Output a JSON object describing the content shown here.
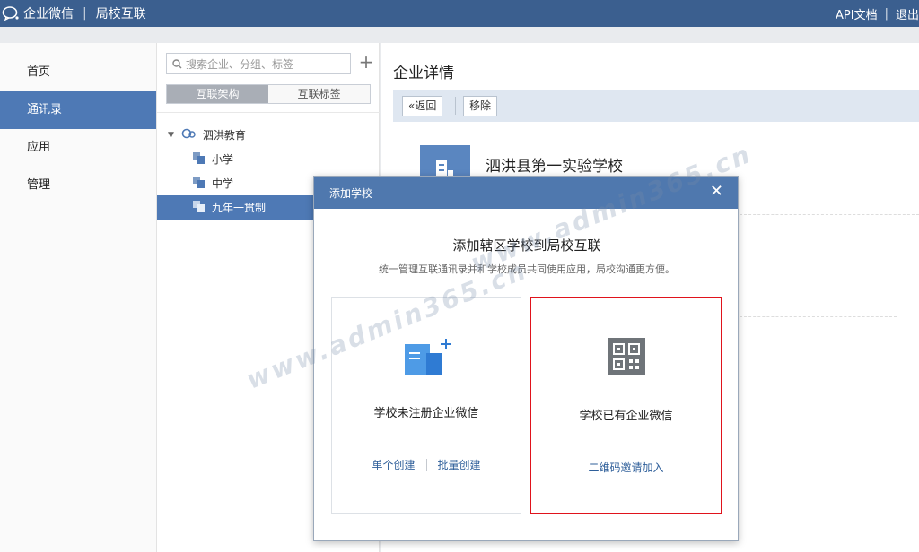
{
  "topbar": {
    "brand": "企业微信",
    "section": "局校互联",
    "api_docs": "API文档",
    "logout": "退出"
  },
  "leftnav": {
    "items": [
      {
        "label": "首页"
      },
      {
        "label": "通讯录",
        "active": true
      },
      {
        "label": "应用"
      },
      {
        "label": "管理"
      }
    ]
  },
  "midcol": {
    "search_placeholder": "搜索企业、分组、标签",
    "tabs": [
      {
        "label": "互联架构",
        "active": true
      },
      {
        "label": "互联标签"
      }
    ],
    "tree": {
      "root": "泗洪教育",
      "children": [
        {
          "label": "小学"
        },
        {
          "label": "中学"
        },
        {
          "label": "九年一贯制",
          "selected": true
        }
      ]
    }
  },
  "content": {
    "title": "企业详情",
    "back_button": "返回",
    "remove_button": "移除",
    "enterprise_name": "泗洪县第一实验学校"
  },
  "modal": {
    "header": "添加学校",
    "title": "添加辖区学校到局校互联",
    "subtitle": "统一管理互联通讯录并和学校成员共同使用应用，局校沟通更方便。",
    "card_unregistered": {
      "label": "学校未注册企业微信",
      "action_single": "单个创建",
      "action_batch": "批量创建"
    },
    "card_registered": {
      "label": "学校已有企业微信",
      "action_qr": "二维码邀请加入"
    }
  },
  "watermark": "www.admin365.cn",
  "colors": {
    "topbar": "#3b5f8f",
    "accent": "#4e79b5",
    "modal_header": "#4f78ae",
    "highlight_border": "#e0131c",
    "link": "#2f5f9a"
  }
}
